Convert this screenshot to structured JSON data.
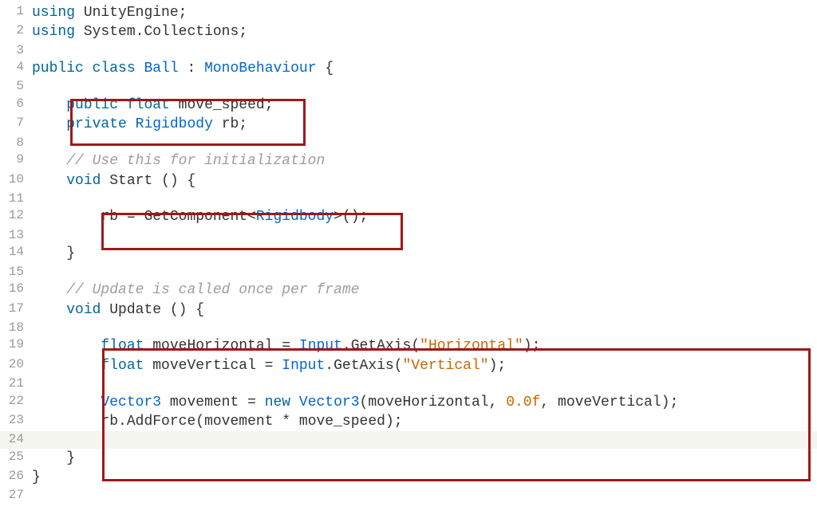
{
  "lines": [
    {
      "num": "1",
      "tokens": [
        {
          "t": "kw-using",
          "v": "using"
        },
        {
          "t": "punct",
          "v": " "
        },
        {
          "t": "ident",
          "v": "UnityEngine"
        },
        {
          "t": "punct",
          "v": ";"
        }
      ]
    },
    {
      "num": "2",
      "tokens": [
        {
          "t": "kw-using",
          "v": "using"
        },
        {
          "t": "punct",
          "v": " "
        },
        {
          "t": "ident",
          "v": "System"
        },
        {
          "t": "punct",
          "v": "."
        },
        {
          "t": "ident",
          "v": "Collections"
        },
        {
          "t": "punct",
          "v": ";"
        }
      ]
    },
    {
      "num": "3",
      "tokens": []
    },
    {
      "num": "4",
      "tokens": [
        {
          "t": "kw-public",
          "v": "public"
        },
        {
          "t": "punct",
          "v": " "
        },
        {
          "t": "kw-class",
          "v": "class"
        },
        {
          "t": "punct",
          "v": " "
        },
        {
          "t": "class-name",
          "v": "Ball"
        },
        {
          "t": "punct",
          "v": " : "
        },
        {
          "t": "type-name",
          "v": "MonoBehaviour"
        },
        {
          "t": "punct",
          "v": " {"
        }
      ]
    },
    {
      "num": "5",
      "tokens": []
    },
    {
      "num": "6",
      "tokens": [
        {
          "t": "punct",
          "v": "    "
        },
        {
          "t": "kw-public",
          "v": "public"
        },
        {
          "t": "punct",
          "v": " "
        },
        {
          "t": "kw-float",
          "v": "float"
        },
        {
          "t": "punct",
          "v": " "
        },
        {
          "t": "ident",
          "v": "move_speed"
        },
        {
          "t": "punct",
          "v": ";"
        }
      ]
    },
    {
      "num": "7",
      "tokens": [
        {
          "t": "punct",
          "v": "    "
        },
        {
          "t": "kw-private",
          "v": "private"
        },
        {
          "t": "punct",
          "v": " "
        },
        {
          "t": "type-name",
          "v": "Rigidbody"
        },
        {
          "t": "punct",
          "v": " "
        },
        {
          "t": "ident",
          "v": "rb"
        },
        {
          "t": "punct",
          "v": ";"
        }
      ]
    },
    {
      "num": "8",
      "tokens": []
    },
    {
      "num": "9",
      "tokens": [
        {
          "t": "punct",
          "v": "    "
        },
        {
          "t": "comment",
          "v": "// Use this for initialization"
        }
      ]
    },
    {
      "num": "10",
      "tokens": [
        {
          "t": "punct",
          "v": "    "
        },
        {
          "t": "kw-void",
          "v": "void"
        },
        {
          "t": "punct",
          "v": " "
        },
        {
          "t": "method-name",
          "v": "Start"
        },
        {
          "t": "punct",
          "v": " () {"
        }
      ]
    },
    {
      "num": "11",
      "tokens": []
    },
    {
      "num": "12",
      "tokens": [
        {
          "t": "punct",
          "v": "        "
        },
        {
          "t": "ident",
          "v": "rb"
        },
        {
          "t": "punct",
          "v": " = "
        },
        {
          "t": "ident",
          "v": "GetComponent"
        },
        {
          "t": "punct",
          "v": "<"
        },
        {
          "t": "type-name",
          "v": "Rigidbody"
        },
        {
          "t": "punct",
          "v": ">();"
        }
      ]
    },
    {
      "num": "13",
      "tokens": []
    },
    {
      "num": "14",
      "tokens": [
        {
          "t": "punct",
          "v": "    }"
        }
      ]
    },
    {
      "num": "15",
      "tokens": []
    },
    {
      "num": "16",
      "tokens": [
        {
          "t": "punct",
          "v": "    "
        },
        {
          "t": "comment",
          "v": "// Update is called once per frame"
        }
      ]
    },
    {
      "num": "17",
      "tokens": [
        {
          "t": "punct",
          "v": "    "
        },
        {
          "t": "kw-void",
          "v": "void"
        },
        {
          "t": "punct",
          "v": " "
        },
        {
          "t": "method-name",
          "v": "Update"
        },
        {
          "t": "punct",
          "v": " () {"
        }
      ]
    },
    {
      "num": "18",
      "tokens": []
    },
    {
      "num": "19",
      "tokens": [
        {
          "t": "punct",
          "v": "        "
        },
        {
          "t": "kw-float",
          "v": "float"
        },
        {
          "t": "punct",
          "v": " "
        },
        {
          "t": "ident",
          "v": "moveHorizontal"
        },
        {
          "t": "punct",
          "v": " = "
        },
        {
          "t": "type-name",
          "v": "Input"
        },
        {
          "t": "punct",
          "v": "."
        },
        {
          "t": "ident",
          "v": "GetAxis"
        },
        {
          "t": "punct",
          "v": "("
        },
        {
          "t": "string",
          "v": "\"Horizontal\""
        },
        {
          "t": "punct",
          "v": ");"
        }
      ]
    },
    {
      "num": "20",
      "tokens": [
        {
          "t": "punct",
          "v": "        "
        },
        {
          "t": "kw-float",
          "v": "float"
        },
        {
          "t": "punct",
          "v": " "
        },
        {
          "t": "ident",
          "v": "moveVertical"
        },
        {
          "t": "punct",
          "v": " = "
        },
        {
          "t": "type-name",
          "v": "Input"
        },
        {
          "t": "punct",
          "v": "."
        },
        {
          "t": "ident",
          "v": "GetAxis"
        },
        {
          "t": "punct",
          "v": "("
        },
        {
          "t": "string",
          "v": "\"Vertical\""
        },
        {
          "t": "punct",
          "v": ");"
        }
      ]
    },
    {
      "num": "21",
      "tokens": []
    },
    {
      "num": "22",
      "tokens": [
        {
          "t": "punct",
          "v": "        "
        },
        {
          "t": "type-name",
          "v": "Vector3"
        },
        {
          "t": "punct",
          "v": " "
        },
        {
          "t": "ident",
          "v": "movement"
        },
        {
          "t": "punct",
          "v": " = "
        },
        {
          "t": "kw-new",
          "v": "new"
        },
        {
          "t": "punct",
          "v": " "
        },
        {
          "t": "type-name",
          "v": "Vector3"
        },
        {
          "t": "punct",
          "v": "("
        },
        {
          "t": "ident",
          "v": "moveHorizontal"
        },
        {
          "t": "punct",
          "v": ", "
        },
        {
          "t": "number",
          "v": "0.0f"
        },
        {
          "t": "punct",
          "v": ", "
        },
        {
          "t": "ident",
          "v": "moveVertical"
        },
        {
          "t": "punct",
          "v": ");"
        }
      ]
    },
    {
      "num": "23",
      "tokens": [
        {
          "t": "punct",
          "v": "        "
        },
        {
          "t": "ident",
          "v": "rb"
        },
        {
          "t": "punct",
          "v": "."
        },
        {
          "t": "ident",
          "v": "AddForce"
        },
        {
          "t": "punct",
          "v": "("
        },
        {
          "t": "ident",
          "v": "movement"
        },
        {
          "t": "punct",
          "v": " * "
        },
        {
          "t": "ident",
          "v": "move_speed"
        },
        {
          "t": "punct",
          "v": ");"
        }
      ]
    },
    {
      "num": "24",
      "highlight": true,
      "tokens": []
    },
    {
      "num": "25",
      "tokens": [
        {
          "t": "punct",
          "v": "    }"
        }
      ]
    },
    {
      "num": "26",
      "tokens": [
        {
          "t": "punct",
          "v": "}"
        }
      ]
    },
    {
      "num": "27",
      "tokens": []
    }
  ]
}
